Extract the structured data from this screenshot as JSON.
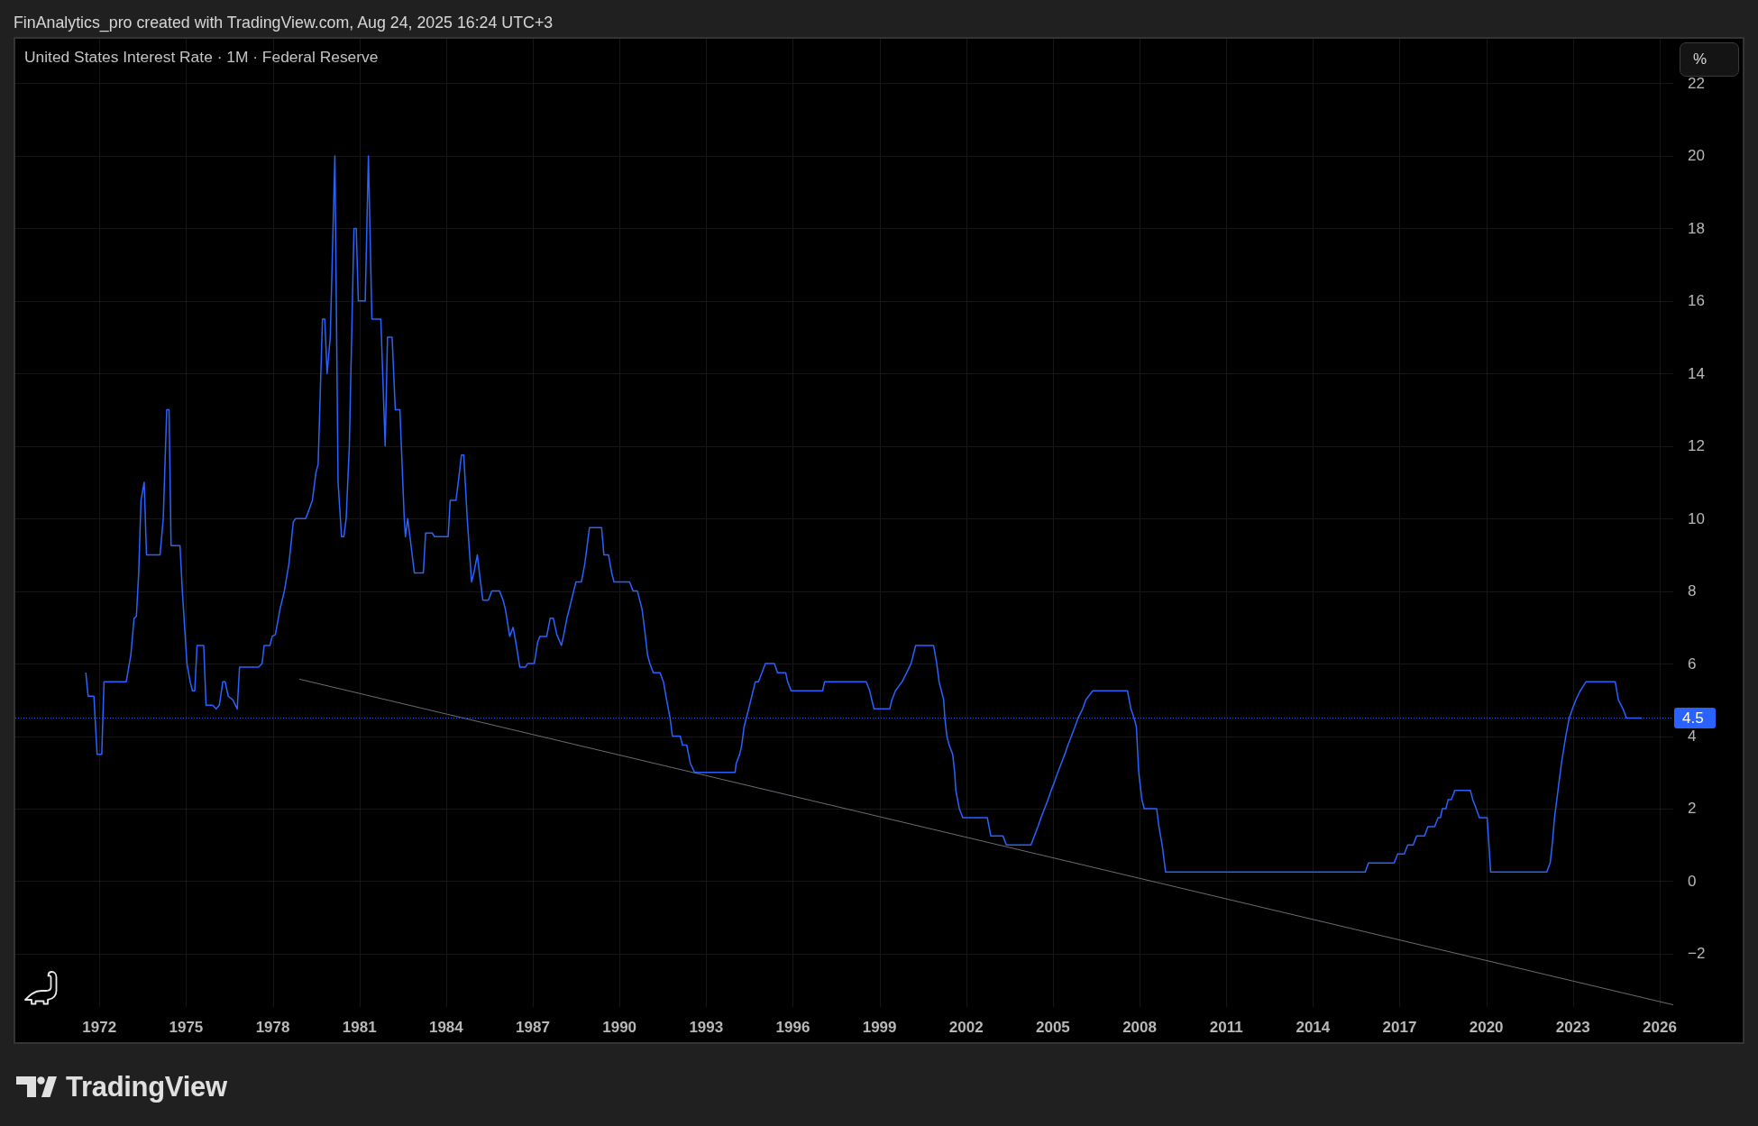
{
  "header": {
    "text": "FinAnalytics_pro created with TradingView.com, Aug 24, 2025 16:24 UTC+3"
  },
  "chart": {
    "unit_button": "%",
    "last_value_label": "4.5",
    "chart_data": {
      "type": "line",
      "title": "United States Interest Rate · 1M · Federal Reserve",
      "grid": true,
      "x": [
        1971.53,
        1971.61,
        1971.81,
        1971.92,
        1972.08,
        1972.16,
        1972.93,
        1973.09,
        1973.2,
        1973.28,
        1973.36,
        1973.44,
        1973.55,
        1973.63,
        1974.1,
        1974.21,
        1974.29,
        1974.33,
        1974.41,
        1974.48,
        1974.79,
        1974.87,
        1974.95,
        1975.03,
        1975.14,
        1975.22,
        1975.3,
        1975.38,
        1975.61,
        1975.69,
        1975.92,
        1976.04,
        1976.15,
        1976.27,
        1976.35,
        1976.46,
        1976.62,
        1976.77,
        1976.85,
        1977.51,
        1977.63,
        1977.7,
        1977.9,
        1977.98,
        1978.09,
        1978.25,
        1978.4,
        1978.56,
        1978.71,
        1978.79,
        1979.14,
        1979.26,
        1979.37,
        1979.49,
        1979.57,
        1979.72,
        1979.8,
        1979.88,
        1979.99,
        1980.15,
        1980.26,
        1980.38,
        1980.46,
        1980.54,
        1980.65,
        1980.81,
        1980.89,
        1980.96,
        1981.2,
        1981.31,
        1981.43,
        1981.74,
        1981.89,
        1981.97,
        1982.13,
        1982.24,
        1982.4,
        1982.55,
        1982.59,
        1982.67,
        1982.9,
        1983.21,
        1983.29,
        1983.52,
        1983.6,
        1984.07,
        1984.14,
        1984.34,
        1984.42,
        1984.53,
        1984.61,
        1984.73,
        1984.88,
        1984.96,
        1985.08,
        1985.15,
        1985.27,
        1985.46,
        1985.58,
        1985.85,
        1985.97,
        1986.05,
        1986.2,
        1986.32,
        1986.43,
        1986.55,
        1986.74,
        1986.82,
        1987.05,
        1987.17,
        1987.25,
        1987.48,
        1987.6,
        1987.71,
        1987.83,
        1987.99,
        1988.06,
        1988.18,
        1988.26,
        1988.49,
        1988.68,
        1988.8,
        1988.96,
        1989.38,
        1989.46,
        1989.62,
        1989.73,
        1989.81,
        1990.35,
        1990.47,
        1990.62,
        1990.7,
        1990.78,
        1990.86,
        1990.97,
        1991.05,
        1991.17,
        1991.4,
        1991.52,
        1991.63,
        1991.75,
        1991.83,
        1992.1,
        1992.18,
        1992.33,
        1992.45,
        1992.6,
        1994.0,
        1994.04,
        1994.16,
        1994.23,
        1994.31,
        1994.47,
        1994.7,
        1994.81,
        1995.05,
        1995.36,
        1995.47,
        1995.75,
        1995.82,
        1995.94,
        1997.03,
        1997.1,
        1998.54,
        1998.66,
        1998.73,
        1998.81,
        1999.35,
        1999.43,
        1999.55,
        1999.78,
        1999.94,
        2000.09,
        2000.25,
        2000.87,
        2000.98,
        2001.06,
        2001.22,
        2001.26,
        2001.33,
        2001.41,
        2001.53,
        2001.6,
        2001.64,
        2001.76,
        2001.88,
        2002.73,
        2002.85,
        2003.27,
        2003.39,
        2004.24,
        2004.36,
        2004.48,
        2004.59,
        2004.71,
        2004.83,
        2004.94,
        2005.06,
        2005.17,
        2005.29,
        2005.41,
        2005.52,
        2005.64,
        2005.76,
        2005.87,
        2006.03,
        2006.14,
        2006.38,
        2007.58,
        2007.7,
        2007.81,
        2007.89,
        2007.97,
        2008.08,
        2008.16,
        2008.59,
        2008.67,
        2008.78,
        2008.9,
        2015.81,
        2015.92,
        2016.81,
        2016.93,
        2017.16,
        2017.28,
        2017.47,
        2017.59,
        2017.86,
        2017.98,
        2018.21,
        2018.33,
        2018.41,
        2018.48,
        2018.6,
        2018.68,
        2018.79,
        2018.91,
        2019.45,
        2019.53,
        2019.65,
        2019.76,
        2020.03,
        2020.15,
        2022.09,
        2022.21,
        2022.28,
        2022.36,
        2022.48,
        2022.6,
        2022.75,
        2022.87,
        2022.98,
        2023.1,
        2023.25,
        2023.45,
        2024.46,
        2024.57,
        2024.73,
        2024.85,
        2025.39
      ],
      "series": [
        {
          "color": "#2962ff",
          "values": [
            5.75,
            5.1,
            5.1,
            3.5,
            3.5,
            5.5,
            5.5,
            6.25,
            7.25,
            7.3,
            8.5,
            10.5,
            11,
            9,
            9,
            10,
            12,
            13,
            13,
            9.25,
            9.25,
            8,
            7,
            6,
            5.5,
            5.25,
            5.25,
            6.5,
            6.5,
            4.85,
            4.85,
            4.75,
            4.85,
            5.5,
            5.5,
            5.1,
            5,
            4.75,
            5.9,
            5.9,
            6,
            6.5,
            6.5,
            6.75,
            6.8,
            7.5,
            8,
            8.75,
            9.9,
            10,
            10,
            10.25,
            10.5,
            11.25,
            11.5,
            15.5,
            15.5,
            14,
            15,
            20,
            11,
            9.5,
            9.5,
            10,
            12,
            18,
            18,
            16,
            16,
            20,
            15.5,
            15.5,
            12,
            15,
            15,
            13,
            13,
            10,
            9.5,
            10,
            8.5,
            8.5,
            9.6,
            9.6,
            9.5,
            9.5,
            10.5,
            10.5,
            11,
            11.75,
            11.75,
            10,
            8.25,
            8.5,
            9,
            8.5,
            7.75,
            7.75,
            8,
            8,
            7.75,
            7.5,
            6.75,
            7,
            6.5,
            5.9,
            5.9,
            6,
            6,
            6.6,
            6.75,
            6.75,
            7.25,
            7.25,
            6.8,
            6.5,
            6.75,
            7.25,
            7.5,
            8.25,
            8.25,
            8.75,
            9.75,
            9.75,
            9,
            9,
            8.5,
            8.25,
            8.25,
            8,
            8,
            7.75,
            7.5,
            7,
            6.25,
            6,
            5.75,
            5.75,
            5.5,
            5,
            4.5,
            4,
            4,
            3.75,
            3.75,
            3.25,
            3,
            3,
            3.25,
            3.5,
            3.75,
            4.25,
            4.75,
            5.5,
            5.5,
            6,
            6,
            5.75,
            5.75,
            5.5,
            5.25,
            5.25,
            5.5,
            5.5,
            5.25,
            5,
            4.75,
            4.75,
            5,
            5.25,
            5.5,
            5.75,
            6,
            6.5,
            6.5,
            6,
            5.5,
            5,
            4.5,
            4,
            3.75,
            3.5,
            3,
            2.5,
            2,
            1.75,
            1.75,
            1.25,
            1.25,
            1,
            1,
            1.25,
            1.5,
            1.75,
            2,
            2.25,
            2.5,
            2.75,
            3,
            3.25,
            3.5,
            3.75,
            4,
            4.25,
            4.5,
            4.75,
            5,
            5.25,
            5.25,
            4.75,
            4.5,
            4.25,
            3,
            2.25,
            2,
            2,
            1.5,
            1,
            0.25,
            0.25,
            0.5,
            0.5,
            0.75,
            0.75,
            1,
            1,
            1.25,
            1.25,
            1.5,
            1.5,
            1.75,
            1.75,
            2,
            2,
            2.25,
            2.25,
            2.5,
            2.5,
            2.25,
            2,
            1.75,
            1.75,
            0.25,
            0.25,
            0.5,
            1,
            1.75,
            2.5,
            3.25,
            4,
            4.5,
            4.75,
            5,
            5.25,
            5.5,
            5.5,
            5,
            4.75,
            4.5,
            4.5
          ]
        }
      ],
      "xlim": [
        1969.09,
        2026.47
      ],
      "ylim": [
        -3.47,
        23.23
      ],
      "xticks": [
        1972,
        1975,
        1978,
        1981,
        1984,
        1987,
        1990,
        1993,
        1996,
        1999,
        2002,
        2005,
        2008,
        2011,
        2014,
        2017,
        2020,
        2023,
        2026
      ],
      "yticks": [
        {
          "value": -2,
          "label": "−2"
        },
        0,
        2,
        4,
        6,
        8,
        10,
        12,
        14,
        16,
        18,
        20,
        22
      ]
    }
  },
  "footer": {
    "brand": "TradingView"
  }
}
